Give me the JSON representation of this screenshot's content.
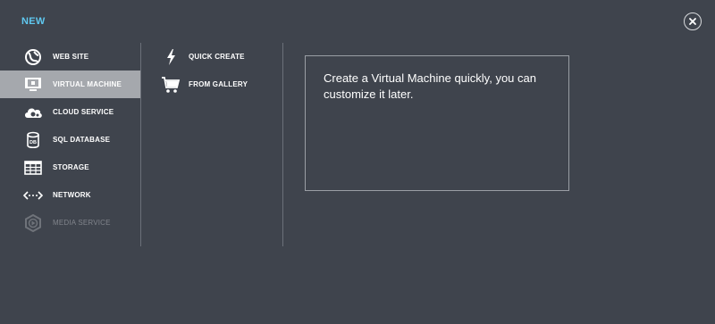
{
  "header": {
    "title": "NEW",
    "close_icon": "close-icon"
  },
  "categories": [
    {
      "label": "WEB SITE",
      "icon": "globe-icon",
      "selected": false,
      "disabled": false
    },
    {
      "label": "VIRTUAL MACHINE",
      "icon": "monitor-icon",
      "selected": true,
      "disabled": false
    },
    {
      "label": "CLOUD SERVICE",
      "icon": "cloud-gear-icon",
      "selected": false,
      "disabled": false
    },
    {
      "label": "SQL DATABASE",
      "icon": "database-icon",
      "selected": false,
      "disabled": false
    },
    {
      "label": "STORAGE",
      "icon": "storage-grid-icon",
      "selected": false,
      "disabled": false
    },
    {
      "label": "NETWORK",
      "icon": "network-arrows-icon",
      "selected": false,
      "disabled": false
    },
    {
      "label": "MEDIA SERVICE",
      "icon": "media-service-icon",
      "selected": false,
      "disabled": true
    }
  ],
  "options": [
    {
      "label": "QUICK CREATE",
      "icon": "lightning-icon"
    },
    {
      "label": "FROM GALLERY",
      "icon": "cart-icon"
    }
  ],
  "description": {
    "text": "Create a Virtual Machine quickly, you can customize it later."
  },
  "colors": {
    "background": "#3f444d",
    "accent": "#5fc8f0",
    "selected": "#a5a8ad",
    "disabled": "#80848b"
  }
}
